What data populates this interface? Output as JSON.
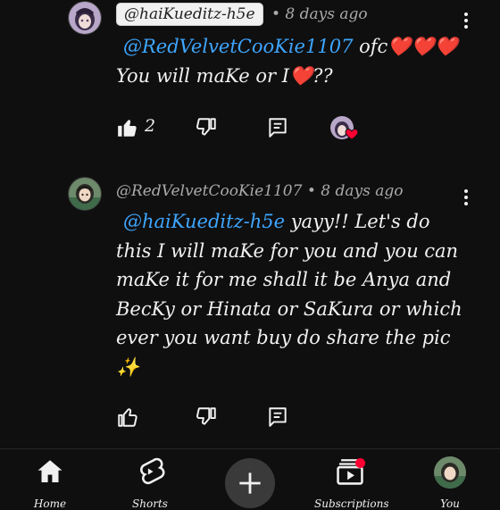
{
  "comments": [
    {
      "author": "@haiKueditz-h5e",
      "separator": "•",
      "time": "8 days ago",
      "mention": "@RedVelvetCooKie1107",
      "text_line1": "ofc❤️❤️❤️",
      "text_line2": "You will maKe or I❤️??",
      "like_count": "2",
      "creator_heart": true,
      "avatar_icon": "anime-avatar-purple",
      "author_style": "highlighted-pill"
    },
    {
      "author": "@RedVelvetCooKie1107",
      "separator": "•",
      "time": "8 days ago",
      "mention": "@haiKueditz-h5e",
      "text": " yayy!! Let's do this I will maKe for you and you can maKe it for me shall it be Anya and BecKy or Hinata or SaKura or which ever you want buy do share the pic ✨",
      "like_count": "",
      "avatar_icon": "anime-avatar-green"
    }
  ],
  "nav": {
    "items": [
      {
        "label": "Home",
        "icon": "home-icon",
        "active": true
      },
      {
        "label": "Shorts",
        "icon": "shorts-icon"
      },
      {
        "label": "",
        "icon": "create-plus-icon"
      },
      {
        "label": "Subscriptions",
        "icon": "subscriptions-icon",
        "badge": true
      },
      {
        "label": "You",
        "icon": "profile-avatar-icon"
      }
    ]
  },
  "colors": {
    "background": "#0f0f0f",
    "text": "#f1f1f1",
    "meta": "#aaaaaa",
    "mention": "#3ea6ff",
    "heart": "#ff0033"
  }
}
